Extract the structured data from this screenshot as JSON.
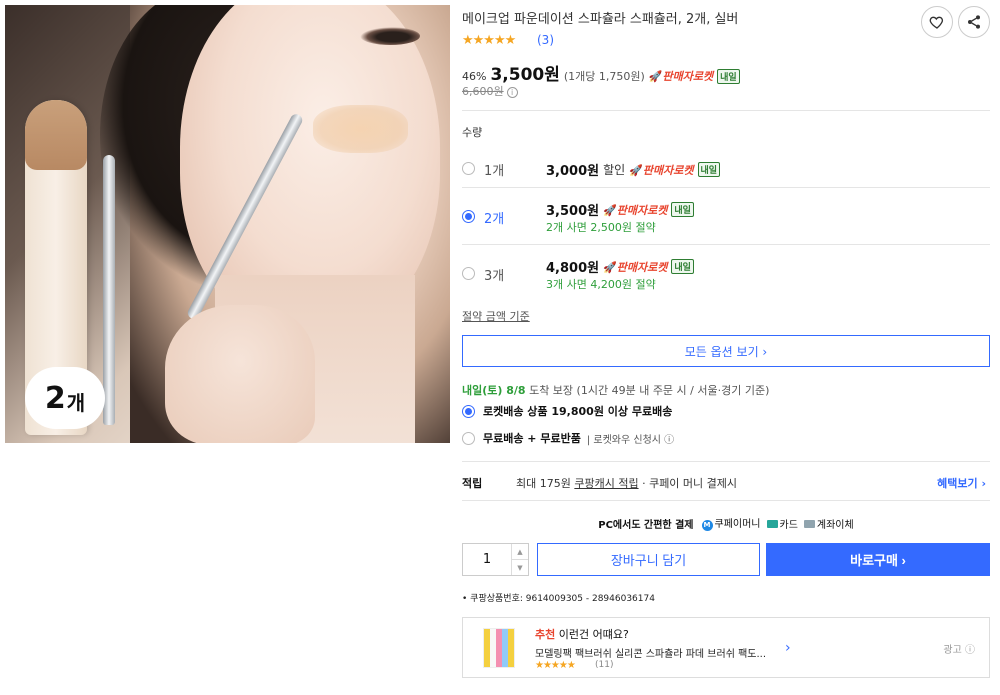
{
  "product": {
    "title": "메이크업 파운데이션 스파츌라 스패츌러, 2개, 실버",
    "stars": "★★★★★",
    "review_count": "(3)",
    "discount": "46%",
    "price": "3,500원",
    "unit_price": "(1개당 1,750원)",
    "rocket_label": "판매자로켓",
    "tomorrow_tag": "내일",
    "original_price": "6,600원",
    "image_badge_num": "2",
    "image_badge_unit": "개"
  },
  "icons": {
    "wishlist": "heart-icon",
    "share": "share-icon",
    "info": "ⓘ"
  },
  "quantity": {
    "label": "수량",
    "options": [
      {
        "count": "1개",
        "price": "3,000원",
        "extra": "할인",
        "save": "",
        "selected": false
      },
      {
        "count": "2개",
        "price": "3,500원",
        "extra": "",
        "save": "2개 사면 2,500원 절약",
        "selected": true
      },
      {
        "count": "3개",
        "price": "4,800원",
        "extra": "",
        "save": "3개 사면 4,200원 절약",
        "selected": false
      }
    ],
    "basis_link": "절약 금액 기준",
    "all_options": "모든 옵션 보기 ›"
  },
  "delivery": {
    "arrival": "내일(토) 8/8",
    "arrival_suffix": " 도착 보장",
    "detail": " (1시간 49분 내 주문 시 / 서울·경기 기준)",
    "opt1_bold": "로켓배송 상품 19,800원 이상 무료배송",
    "opt2_bold": "무료배송 + 무료반품",
    "opt2_sub": "| 로켓와우 신청시 ⓘ"
  },
  "reward": {
    "label": "적립",
    "prefix": "최대 175원 ",
    "link": "쿠팡캐시 적립",
    "suffix": " · 쿠페이 머니 결제시",
    "more": "혜택보기 ›"
  },
  "payment": {
    "lead": "PC에서도 간편한 결제",
    "coupay": "쿠페이머니",
    "card": "카드",
    "bank": "계좌이체"
  },
  "actions": {
    "qty_value": "1",
    "up": "▲",
    "down": "▼",
    "cart": "장바구니 담기",
    "buy": "바로구매 ›"
  },
  "product_number": "• 쿠팡상품번호: 9614009305 - 28946036174",
  "recommendation": {
    "head_red": "추천",
    "head_rest": " 이런건 어떄요?",
    "name": "모델링팩 팩브러쉬 실리콘 스파츌라 파데 브러쉬 팩도...",
    "stars": "★★★★★",
    "count": "(11)",
    "arrow": "›",
    "ad": "광고 ⓘ"
  },
  "colors": {
    "accent": "#346aff",
    "rocket": "#e8442e",
    "save_green": "#2e9e3a",
    "star": "#f5a623"
  }
}
